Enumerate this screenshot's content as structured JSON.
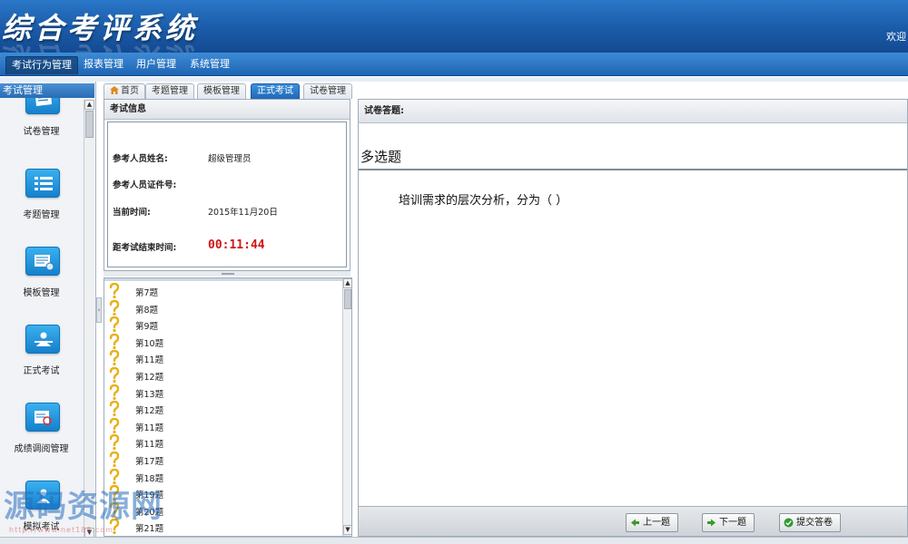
{
  "header": {
    "app_title": "综合考评系统",
    "welcome": "欢迎"
  },
  "menu": {
    "items": [
      "考试行为管理",
      "报表管理",
      "用户管理",
      "系统管理"
    ],
    "active_index": 0
  },
  "left_panel": {
    "title": "考试管理",
    "nav_items": [
      {
        "label": "试卷管理",
        "icon": "paper-icon"
      },
      {
        "label": "考题管理",
        "icon": "list-icon"
      },
      {
        "label": "模板管理",
        "icon": "template-gear-icon"
      },
      {
        "label": "正式考试",
        "icon": "exam-person-icon"
      },
      {
        "label": "成绩调阅管理",
        "icon": "score-review-icon"
      },
      {
        "label": "模拟考试",
        "icon": "mock-exam-icon"
      }
    ]
  },
  "tabs": {
    "items": [
      "首页",
      "考题管理",
      "模板管理",
      "正式考试",
      "试卷管理"
    ],
    "active_index": 3
  },
  "exam_info": {
    "title": "考试信息",
    "name_label": "参考人员姓名:",
    "name_value": "超级管理员",
    "id_label": "参考人员证件号:",
    "id_value": "",
    "time_label": "当前时间:",
    "time_value": "2015年11月20日",
    "remain_label": "距考试结束时间:",
    "remain_value": "00:11:44"
  },
  "question_list": {
    "items": [
      "第7题",
      "第8题",
      "第9题",
      "第10题",
      "第11题",
      "第12题",
      "第13题",
      "第12题",
      "第11题",
      "第11题",
      "第17题",
      "第18题",
      "第19题",
      "第20题",
      "第21题"
    ]
  },
  "answer_panel": {
    "title": "试卷答题:",
    "question_type": "多选题",
    "question_text": "培训需求的层次分析，分为（    ）",
    "prev_button": "上一题",
    "next_button": "下一题",
    "submit_button": "提交答卷"
  },
  "watermark": {
    "text": "源码资源网",
    "url": "http://www.net188.com"
  },
  "colors": {
    "header_blue": "#1a5ba8",
    "active_tab": "#1f68b6",
    "timer_red": "#d21414",
    "question_icon": "#e8b012"
  }
}
